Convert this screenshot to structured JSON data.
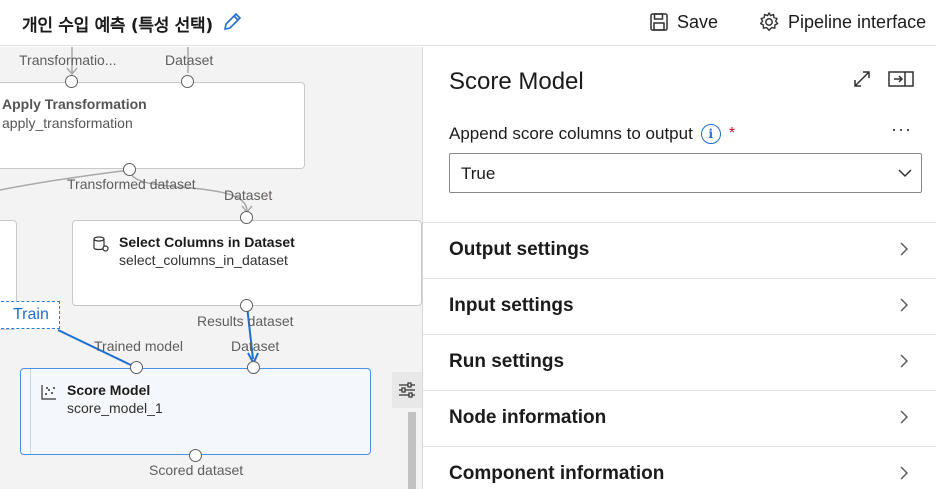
{
  "header": {
    "title": "개인 수입 예측 (특성 선택)",
    "save_label": "Save",
    "pipeline_label": "Pipeline interface"
  },
  "canvas": {
    "port_labels": {
      "transformation_in": "Transformatio...",
      "dataset_in_top": "Dataset",
      "transformed_dataset": "Transformed dataset",
      "dataset_select_in": "Dataset",
      "results_dataset": "Results dataset",
      "trained_model": "Trained model",
      "dataset_score_in": "Dataset",
      "scored_dataset": "Scored dataset"
    },
    "nodes": {
      "apply_transformation": {
        "title": "Apply Transformation",
        "subtitle": "apply_transformation"
      },
      "select_columns": {
        "title": "Select Columns in Dataset",
        "subtitle": "select_columns_in_dataset"
      },
      "score_model": {
        "title": "Score Model",
        "subtitle": "score_model_1"
      }
    },
    "train_tag": "Train",
    "colors": {
      "accent": "#1f6fd1",
      "selected_fill": "#f4f7fb"
    }
  },
  "panel": {
    "title": "Score Model",
    "field_label": "Append score columns to output",
    "required_mark": "*",
    "info_glyph": "i",
    "more_glyph": "···",
    "select_value": "True",
    "sections": [
      {
        "label": "Output settings"
      },
      {
        "label": "Input settings"
      },
      {
        "label": "Run settings"
      },
      {
        "label": "Node information"
      },
      {
        "label": "Component information"
      }
    ]
  },
  "icons": [
    "edit-icon",
    "save-icon",
    "gear-icon",
    "database-icon",
    "scatter-icon",
    "filter-icon",
    "expand-icon",
    "dock-icon",
    "info-icon",
    "more-icon",
    "chevron-down-icon",
    "chevron-right-icon"
  ]
}
